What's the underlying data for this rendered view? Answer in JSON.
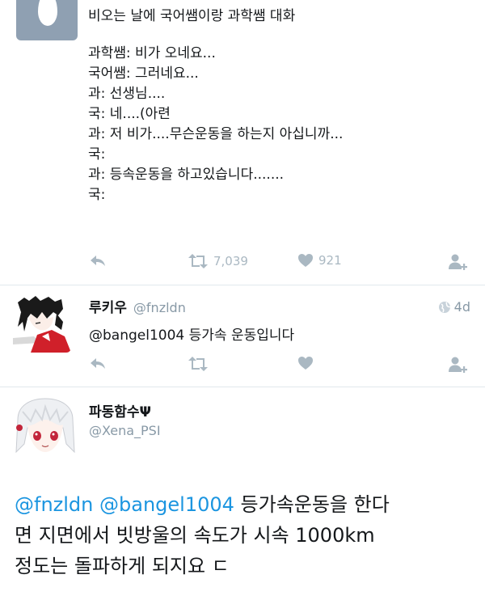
{
  "tweet1": {
    "lines": [
      "비오는 날에 국어쌤이랑 과학쌤 대화",
      "",
      "과학쌤: 비가 오네요...",
      "국어쌤: 그러네요...",
      "과: 선생님....",
      "국: 네....(아련",
      "과: 저 비가....무슨운동을 하는지 아십니까...",
      "국:",
      "과: 등속운동을 하고있습니다.......",
      "국:"
    ],
    "actions": {
      "retweet_count": "7,039",
      "like_count": "921"
    }
  },
  "tweet2": {
    "name": "루키우",
    "handle": "@fnzldn",
    "time": "4d",
    "text": "@bangel1004 등가속 운동입니다"
  },
  "tweet3": {
    "name": "파동함수Ψ",
    "handle": "@Xena_PSI",
    "mention1": "@fnzldn",
    "mention2": "@bangel1004",
    "line1_rest": " 등가속운동을 한다",
    "line2": "면 지면에서 빗방울의 속도가 시속 1000km",
    "line3": "정도는 돌파하게 되지요 ㄷ"
  },
  "colors": {
    "mention": "#1b95e0",
    "icon_gray": "#aab8c2",
    "handle_gray": "#8899a6",
    "egg_bg": "#8fa0b2"
  },
  "icons": [
    "reply-icon",
    "retweet-icon",
    "heart-icon",
    "follow-icon",
    "globe-icon"
  ]
}
